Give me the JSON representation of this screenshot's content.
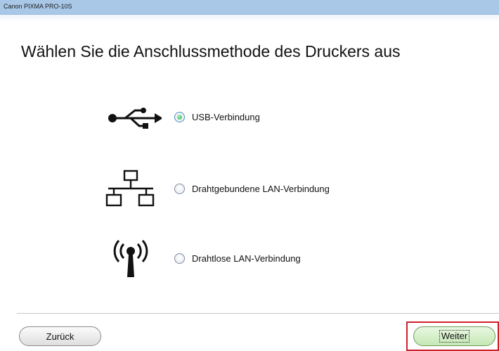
{
  "window": {
    "title": "Canon PIXMA PRO-10S"
  },
  "main": {
    "heading": "Wählen Sie die Anschlussmethode des Druckers aus",
    "options": [
      {
        "icon": "usb-icon",
        "label": "USB-Verbindung",
        "selected": true
      },
      {
        "icon": "wired-lan-icon",
        "label": "Drahtgebundene LAN-Verbindung",
        "selected": false
      },
      {
        "icon": "wireless-lan-icon",
        "label": "Drahtlose LAN-Verbindung",
        "selected": false
      }
    ]
  },
  "footer": {
    "back_label": "Zurück",
    "next_label": "Weiter"
  },
  "colors": {
    "titlebar": "#a9c8e8",
    "radio_selected": "#2fb24f",
    "next_button": "#c5e8b4",
    "highlight": "#d0202a"
  }
}
